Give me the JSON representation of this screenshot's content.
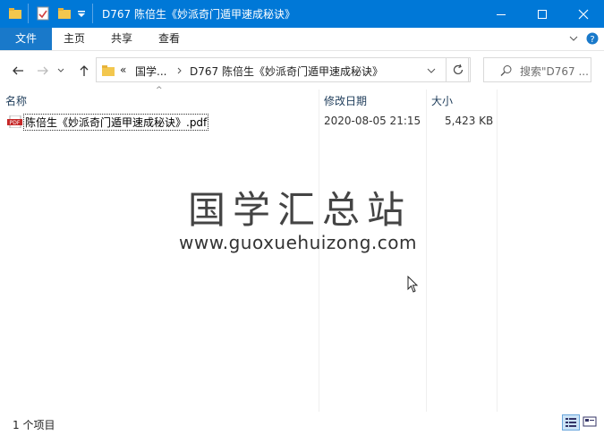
{
  "window": {
    "title": "D767 陈倍生《妙派奇门遁甲速成秘诀》",
    "colors": {
      "titlebar": "#0078d7",
      "file_tab": "#1979ca"
    }
  },
  "ribbon": {
    "tabs": [
      {
        "label": "文件"
      },
      {
        "label": "主页"
      },
      {
        "label": "共享"
      },
      {
        "label": "查看"
      }
    ]
  },
  "address": {
    "overflow": "«",
    "crumbs": [
      {
        "label": "国学..."
      },
      {
        "label": "D767 陈倍生《妙派奇门遁甲速成秘诀》"
      }
    ]
  },
  "search": {
    "placeholder": "搜索\"D767 ..."
  },
  "columns": {
    "name": "名称",
    "date": "修改日期",
    "size": "大小"
  },
  "files": [
    {
      "name": "陈倍生《妙派奇门遁甲速成秘诀》.pdf",
      "date": "2020-08-05 21:15",
      "size": "5,423 KB",
      "icon": "pdf-file-icon",
      "icon_label": "PDF"
    }
  ],
  "watermark": {
    "title": "国学汇总站",
    "url": "www.guoxuehuizong.com"
  },
  "status": {
    "count": "1 个项目"
  }
}
